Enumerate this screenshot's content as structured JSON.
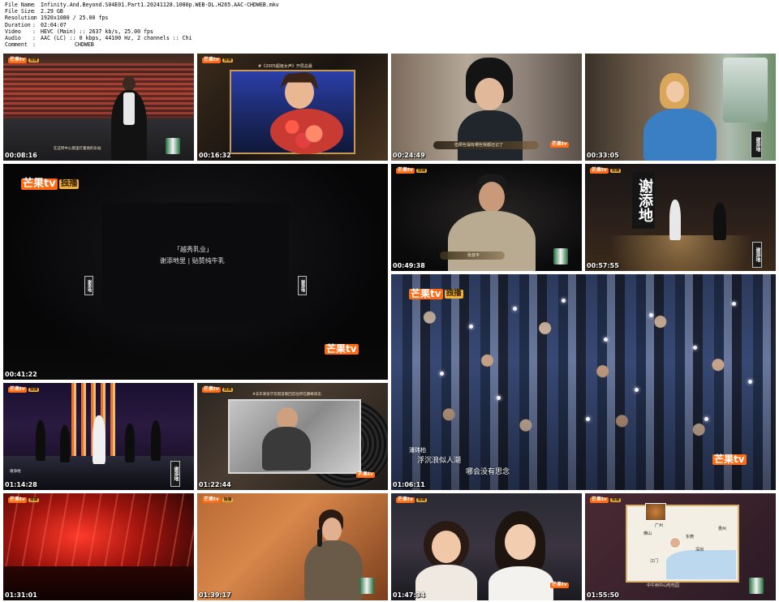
{
  "media_info": {
    "file_name": {
      "label": "File Name",
      "value": "Infinity.And.Beyond.S04E01.Part1.20241128.1080p.WEB-DL.H265.AAC-CHDWEB.mkv"
    },
    "file_size": {
      "label": "File Size",
      "value": "2.29 GB"
    },
    "resolution": {
      "label": "Resolution",
      "value": "1920x1080 / 25.00 fps"
    },
    "duration": {
      "label": "Duration",
      "value": "02:04:07"
    },
    "video": {
      "label": "Video",
      "value": "HEVC (Main) :: 2637 kb/s, 25.00 fps"
    },
    "audio": {
      "label": "Audio",
      "value": "AAC (LC) :: 0 kbps, 44100 Hz, 2 channels :: Chi"
    },
    "comment": {
      "label": "Comment",
      "value": "CHDWEB"
    },
    "separator": ":"
  },
  "brand": {
    "logo_text": "芒果tv",
    "exclusive": "独播",
    "accent": "#ff6a13"
  },
  "thumbnails": [
    {
      "time": "00:08:16",
      "caption": "在这所中心那里打着他的乐站"
    },
    {
      "time": "00:16:32",
      "caption": "#《2005超级女声》开局总最"
    },
    {
      "time": "00:24:49",
      "caption": "但那些漏有哪些我都还记了"
    },
    {
      "time": "00:33:05",
      "caption": ""
    },
    {
      "time": "00:41:22",
      "caption_line1": "「越秀乳业」",
      "caption_line2": "谢添地里 | 贴赞纯牛乳",
      "side_label": "谢添地"
    },
    {
      "time": "00:49:38",
      "caption": "张叔平"
    },
    {
      "time": "00:57:55",
      "big_label": "谢添地",
      "side_label": "谢添地"
    },
    {
      "time": "01:06:11",
      "caption_line1": "潘玮柏",
      "caption_line2": "浮沉浪似人潮",
      "caption_line3": "哪会没有思念"
    },
    {
      "time": "01:14:28",
      "caption": "谢添地",
      "side_label": "谢添地"
    },
    {
      "time": "01:22:44",
      "caption": "#去年来张学友唱首歌回首往所在巅峰状态"
    },
    {
      "time": "01:31:01",
      "caption": ""
    },
    {
      "time": "01:39:17",
      "caption": ""
    },
    {
      "time": "01:47:34",
      "caption": ""
    },
    {
      "time": "01:55:50",
      "caption": "中午到中山吃吃园",
      "map_labels": [
        "佛山",
        "广州",
        "东莞",
        "深圳",
        "江门",
        "惠州"
      ]
    }
  ]
}
